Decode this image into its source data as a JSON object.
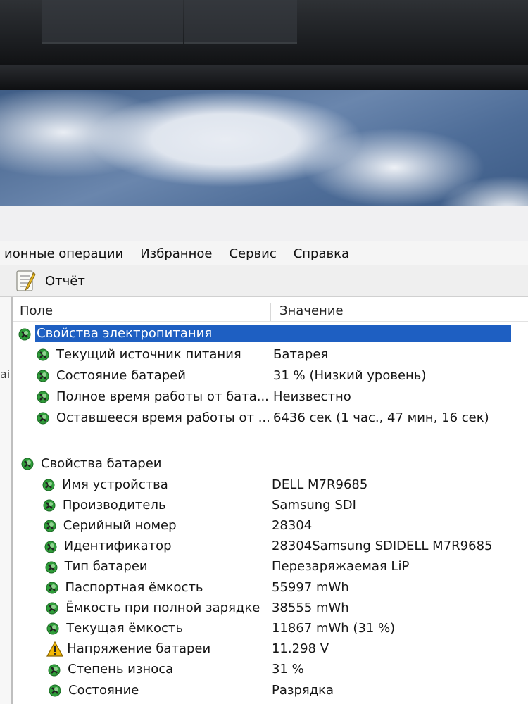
{
  "menu": [
    "ионные операции",
    "Избранное",
    "Сервис",
    "Справка"
  ],
  "toolbar": {
    "report_label": "Отчёт"
  },
  "columns": {
    "field": "Поле",
    "value": "Значение"
  },
  "left_strip_fragments": [
    "ai"
  ],
  "power": {
    "label": "Свойства электропитания",
    "rows": [
      {
        "name": "Текущий источник питания",
        "value": "Батарея"
      },
      {
        "name": "Состояние батарей",
        "value": "31 % (Низкий уровень)"
      },
      {
        "name": "Полное время работы от бата...",
        "value": "Неизвестно"
      },
      {
        "name": "Оставшееся время работы от ...",
        "value": "6436 сек (1 час., 47 мин, 16 сек)"
      }
    ]
  },
  "battery": {
    "label": "Свойства батареи",
    "rows": [
      {
        "name": "Имя устройства",
        "value": "DELL M7R9685",
        "icon": "battery-icon"
      },
      {
        "name": "Производитель",
        "value": "Samsung SDI",
        "icon": "battery-icon"
      },
      {
        "name": "Серийный номер",
        "value": "28304",
        "icon": "battery-icon"
      },
      {
        "name": "Идентификатор",
        "value": "28304Samsung SDIDELL M7R9685",
        "icon": "battery-icon"
      },
      {
        "name": "Тип батареи",
        "value": "Перезаряжаемая LiP",
        "icon": "battery-icon"
      },
      {
        "name": "Паспортная ёмкость",
        "value": "55997 mWh",
        "icon": "battery-icon"
      },
      {
        "name": "Ёмкость при полной зарядке",
        "value": "38555 mWh",
        "icon": "battery-icon"
      },
      {
        "name": "Текущая ёмкость",
        "value": "11867 mWh  (31 %)",
        "icon": "battery-icon"
      },
      {
        "name": "Напряжение батареи",
        "value": "11.298 V",
        "icon": "warning-icon"
      },
      {
        "name": "Степень износа",
        "value": "31 %",
        "icon": "battery-icon"
      },
      {
        "name": "Состояние",
        "value": "Разрядка",
        "icon": "battery-icon"
      }
    ]
  },
  "colors": {
    "selection": "#1e5fc2",
    "icon_green": "#2f9e3a",
    "warning": "#f2b705"
  }
}
